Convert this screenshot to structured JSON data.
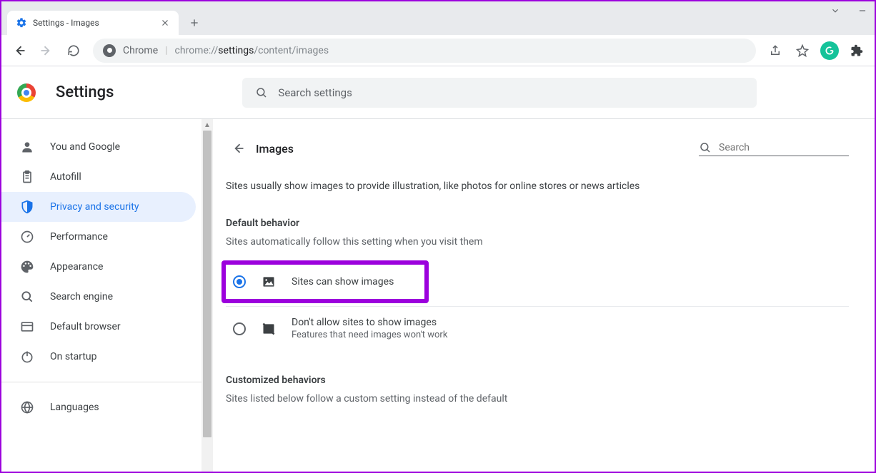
{
  "tab": {
    "title": "Settings - Images"
  },
  "omnibox": {
    "label": "Chrome",
    "url_prefix": "chrome://",
    "url_bold": "settings",
    "url_suffix": "/content/images"
  },
  "header": {
    "title": "Settings",
    "search_placeholder": "Search settings"
  },
  "sidebar": {
    "items": [
      {
        "label": "You and Google"
      },
      {
        "label": "Autofill"
      },
      {
        "label": "Privacy and security"
      },
      {
        "label": "Performance"
      },
      {
        "label": "Appearance"
      },
      {
        "label": "Search engine"
      },
      {
        "label": "Default browser"
      },
      {
        "label": "On startup"
      }
    ],
    "secondary": [
      {
        "label": "Languages"
      }
    ]
  },
  "page": {
    "title": "Images",
    "search_placeholder": "Search",
    "description": "Sites usually show images to provide illustration, like photos for online stores or news articles",
    "default_behavior_h": "Default behavior",
    "default_behavior_sub": "Sites automatically follow this setting when you visit them",
    "options": [
      {
        "label": "Sites can show images",
        "sub": "",
        "checked": true
      },
      {
        "label": "Don't allow sites to show images",
        "sub": "Features that need images won't work",
        "checked": false
      }
    ],
    "customized_h": "Customized behaviors",
    "customized_sub": "Sites listed below follow a custom setting instead of the default"
  },
  "colors": {
    "accent": "#1a73e8",
    "highlight": "#9c00dd"
  }
}
